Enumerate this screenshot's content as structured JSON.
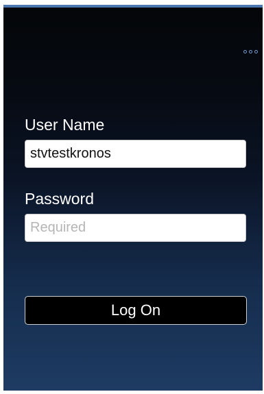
{
  "login": {
    "username_label": "User Name",
    "username_value": "stvtestkronos",
    "password_label": "Password",
    "password_placeholder": "Required",
    "password_value": "",
    "logon_label": "Log On"
  },
  "icons": {
    "overflow_menu": "overflow-menu-icon"
  },
  "colors": {
    "top_bar": "#4c76b0",
    "background_top": "#040608",
    "background_bottom": "#1e3b63",
    "menu_dots": "#6f9ed6",
    "button_background": "#000000",
    "label_text": "#ffffff"
  }
}
